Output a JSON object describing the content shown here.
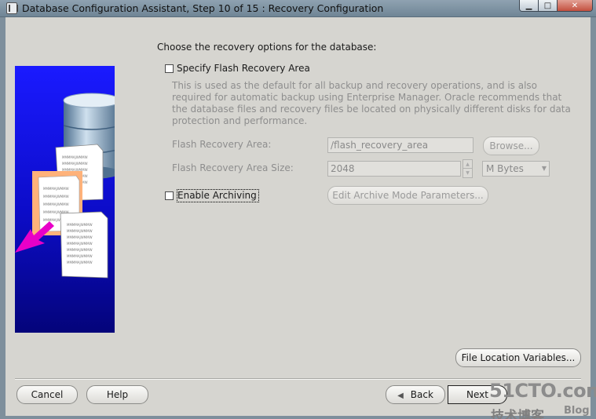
{
  "window": {
    "title": "Database Configuration Assistant, Step 10 of 15 : Recovery Configuration",
    "min_glyph": "▁",
    "max_glyph": "□",
    "close_glyph": "✕"
  },
  "main": {
    "prompt": "Choose the recovery options for the database:",
    "flash_recovery": {
      "checkbox_label": "Specify Flash Recovery Area",
      "checked": false,
      "description": "This is used as the default for all backup and recovery operations, and is also required for automatic backup using Enterprise Manager. Oracle recommends that the database files and recovery files be located on physically different disks for data protection and performance.",
      "area_label": "Flash Recovery Area:",
      "area_value": "/flash_recovery_area",
      "browse_label": "Browse...",
      "size_label": "Flash Recovery Area Size:",
      "size_value": "2048",
      "size_unit": "M Bytes"
    },
    "archiving": {
      "checkbox_label": "Enable Archiving",
      "checked": false,
      "params_button": "Edit Archive Mode Parameters..."
    },
    "file_location_button": "File Location Variables..."
  },
  "illustration": {
    "doc_text": "MMMMAJWMMW"
  },
  "footer": {
    "cancel": "Cancel",
    "help": "Help",
    "back": "Back",
    "next": "Next"
  },
  "watermark": {
    "site": "51CTO.com",
    "chinese": "技术博客",
    "blog": "Blog"
  },
  "colors": {
    "dialog_bg": "#d6d5d0",
    "titlebar": "#7f93a3",
    "illustration_blue": "#1010d0",
    "arrow_magenta": "#e800c8"
  }
}
